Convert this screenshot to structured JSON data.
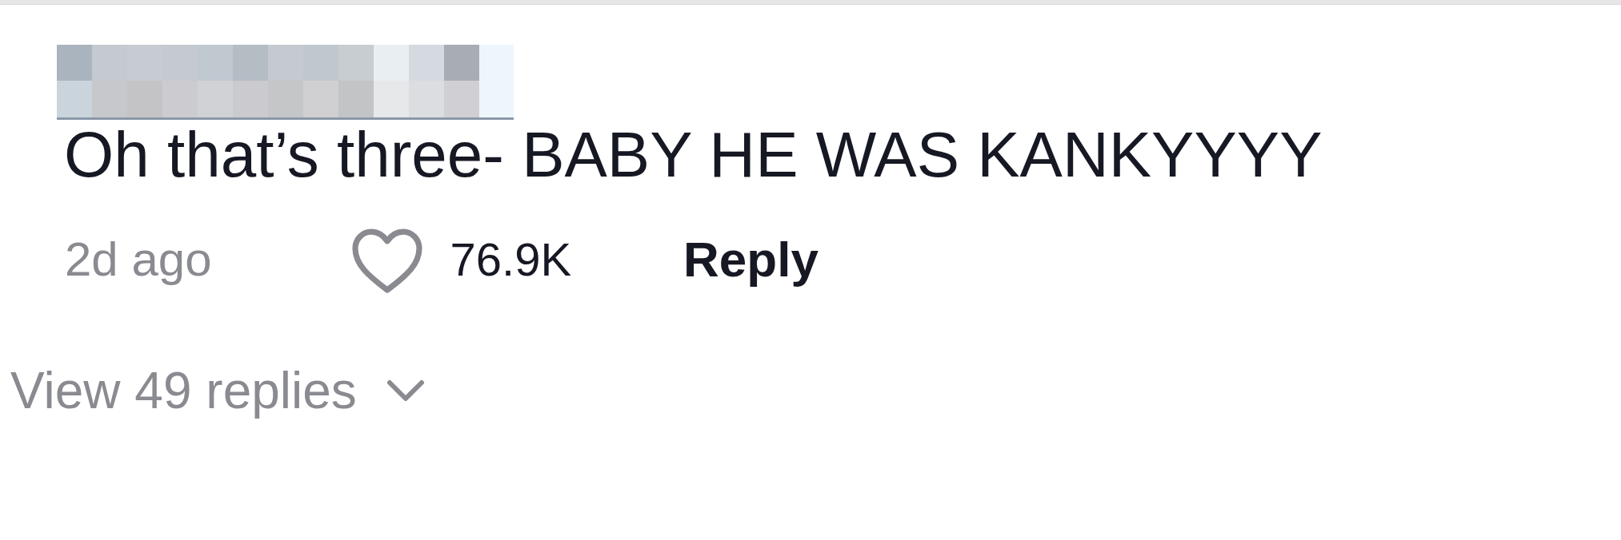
{
  "comment": {
    "text": "Oh that’s three- BABY HE WAS KANKYYYY",
    "time": "2d ago",
    "likes": "76.9K",
    "liked": false,
    "reply": "Reply"
  },
  "view_replies": "View 49 replies"
}
